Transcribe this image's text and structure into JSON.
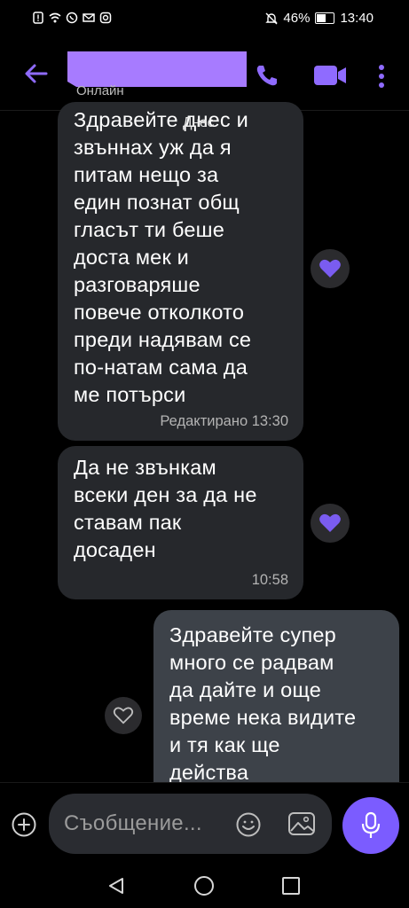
{
  "status_bar": {
    "battery": "46%",
    "time": "13:40",
    "battery_level": 0.46
  },
  "header": {
    "status": "Онлайн"
  },
  "date_chip": "Днес",
  "messages": [
    {
      "direction": "incoming",
      "text": "Здравейте днес и\nзвъннах уж да я\nпитам нещо за\nедин познат общ\nгласът ти беше\nдоста мек и\nразговаряше\nповече отколкото\nпреди надявам се\nпо-натам сама да\nме потърси",
      "meta": "Редактирано 13:30"
    },
    {
      "direction": "incoming",
      "text": "Да не звънкам\nвсеки ден за да не\nставам пак\nдосаден",
      "meta": "10:58"
    },
    {
      "direction": "outgoing",
      "text": "Здравейте супер\nмного се радвам\nда дайте и още\nвреме нека видите\nи тя как ще\nдейства",
      "meta": ""
    }
  ],
  "composer": {
    "placeholder": "Съобщение..."
  },
  "colors": {
    "accent": "#7b5cff",
    "header_icon": "#8f6bff",
    "like_fill": "#7a5cf0",
    "incoming_bubble": "#26282c",
    "outgoing_bubble": "#3d4249",
    "background": "#000000"
  },
  "icons": {
    "back": "arrow-left-icon",
    "call": "phone-icon",
    "video": "video-camera-icon",
    "more": "more-vertical-icon",
    "like": "heart-icon",
    "attach": "plus-icon",
    "emoji": "smiley-icon",
    "gallery": "image-icon",
    "mic": "microphone-icon"
  }
}
